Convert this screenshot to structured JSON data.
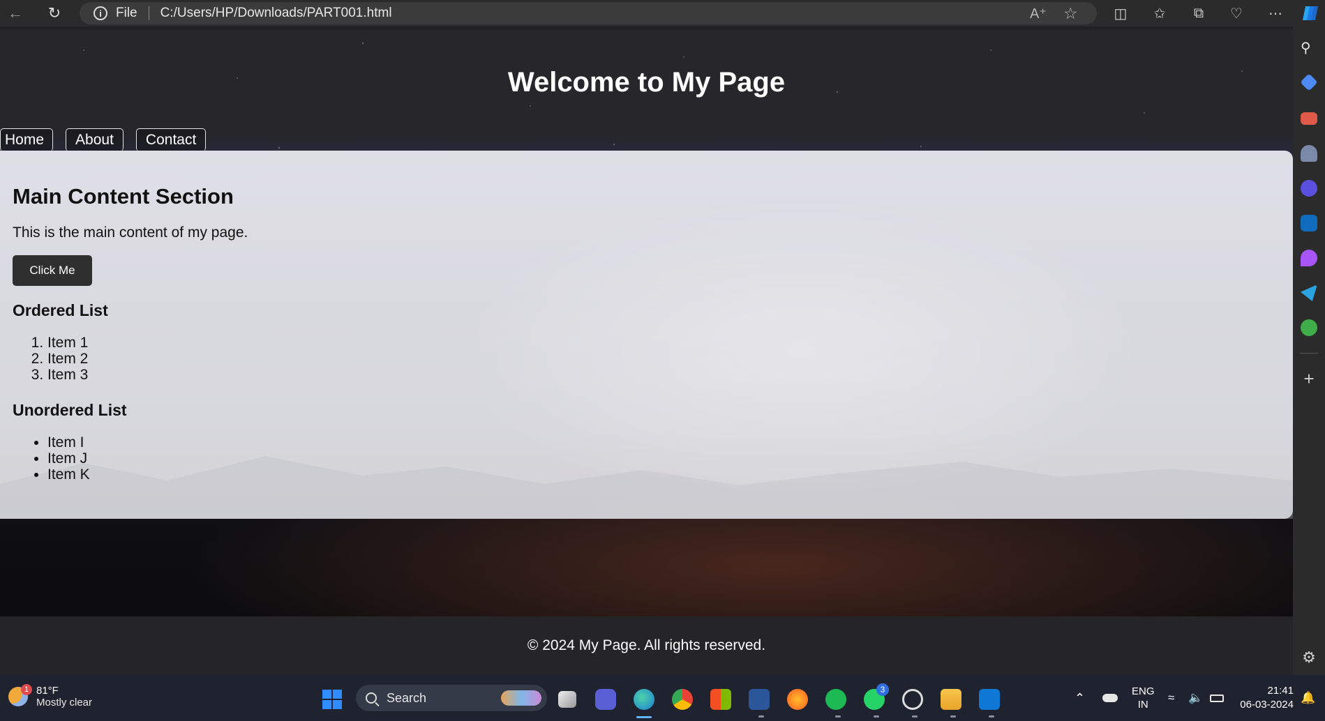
{
  "browser": {
    "protocol_label": "File",
    "url": "C:/Users/HP/Downloads/PART001.html",
    "icons": [
      "back-icon",
      "reload-icon",
      "info-icon",
      "read-aloud-icon",
      "favorite-star-icon",
      "split-screen-icon",
      "favorites-icon",
      "collections-icon",
      "browser-essentials-icon",
      "more-icon",
      "copilot-icon"
    ]
  },
  "sidebar": {
    "icons": [
      "search-icon",
      "tag-icon",
      "toolbox-icon",
      "chess-icon",
      "copilot-designer-icon",
      "outlook-icon",
      "drop-icon",
      "telegram-icon",
      "tree-icon",
      "add-icon",
      "settings-icon"
    ]
  },
  "page": {
    "title": "Welcome to My Page",
    "nav": [
      "Home",
      "About",
      "Contact"
    ],
    "main": {
      "heading": "Main Content Section",
      "description": "This is the main content of my page.",
      "button_label": "Click Me",
      "ordered_heading": "Ordered List",
      "ordered_items": [
        "Item 1",
        "Item 2",
        "Item 3"
      ],
      "unordered_heading": "Unordered List",
      "unordered_items": [
        "Item I",
        "Item J",
        "Item K"
      ]
    },
    "footer": "© 2024 My Page. All rights reserved."
  },
  "taskbar": {
    "weather_temp": "81°F",
    "weather_desc": "Mostly clear",
    "weather_badge": "1",
    "search_label": "Search",
    "whatsapp_badge": "3",
    "lang_top": "ENG",
    "lang_bottom": "IN",
    "time": "21:41",
    "date": "06-03-2024"
  }
}
